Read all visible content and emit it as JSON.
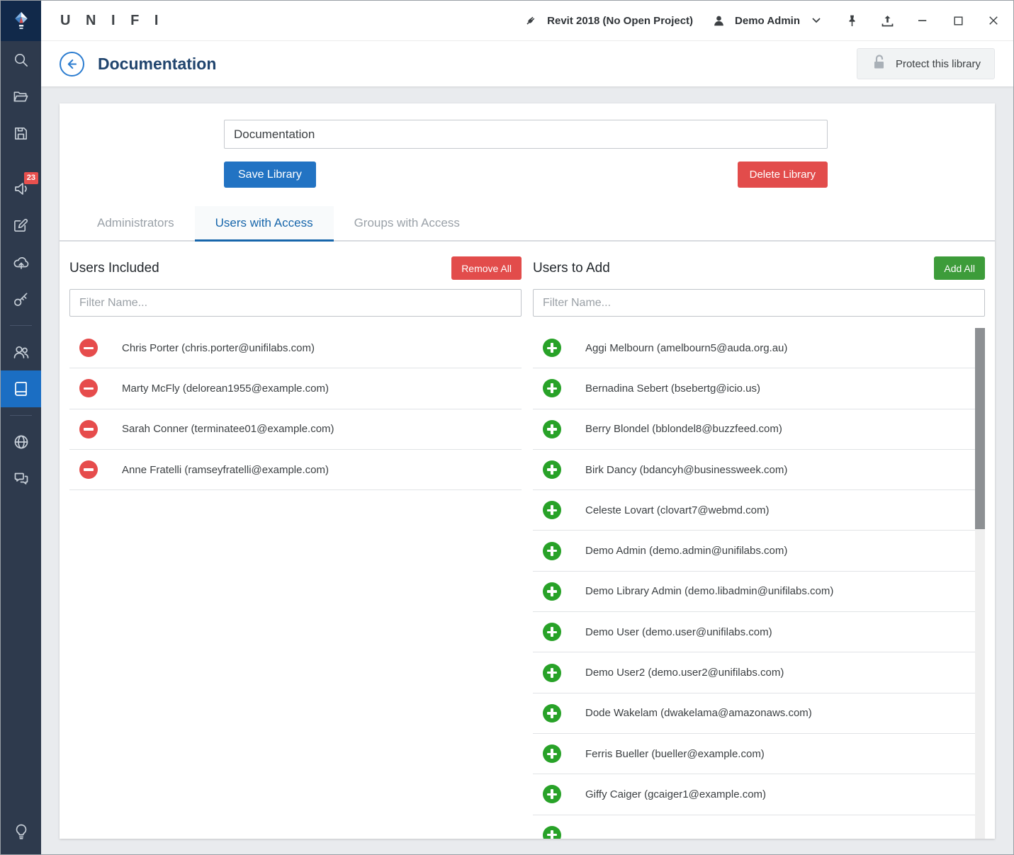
{
  "colors": {
    "sidebar_bg": "#2e3a4d",
    "sidebar_active_bg": "#1b6ec3",
    "accent_blue": "#2273c3",
    "danger_red": "#e24c4b",
    "success_green": "#3d9c3a",
    "badge_red": "#e8504e",
    "title_navy": "#21456e",
    "tab_active_blue": "#1766ab"
  },
  "titlebar": {
    "app_name": "U N I F I",
    "revit_status": "Revit 2018 (No Open Project)",
    "user_name": "Demo Admin",
    "icons": [
      "revit-plugin-icon",
      "user-icon",
      "chevron-down-icon",
      "pin-icon",
      "upload-icon",
      "minimize-icon",
      "maximize-icon",
      "close-icon"
    ]
  },
  "sidebar": {
    "badge_count": "23",
    "active_item": "library-book-icon",
    "icons": [
      "unifi-logo",
      "search-icon",
      "folder-open-icon",
      "save-icon",
      "megaphone-icon",
      "edit-icon",
      "cloud-upload-icon",
      "key-icon",
      "users-icon",
      "library-book-icon",
      "globe-icon",
      "chat-icon",
      "lightbulb-icon"
    ]
  },
  "header": {
    "title": "Documentation",
    "protect_button_label": "Protect this library"
  },
  "library_form": {
    "name_value": "Documentation",
    "save_label": "Save Library",
    "delete_label": "Delete Library"
  },
  "tabs": [
    {
      "label": "Administrators",
      "active": false
    },
    {
      "label": "Users with Access",
      "active": true
    },
    {
      "label": "Groups with Access",
      "active": false
    }
  ],
  "users_included": {
    "title": "Users Included",
    "action_label": "Remove All",
    "filter_placeholder": "Filter Name...",
    "users": [
      "Chris Porter (chris.porter@unifilabs.com)",
      "Marty McFly (delorean1955@example.com)",
      "Sarah Conner (terminatee01@example.com)",
      "Anne Fratelli (ramseyfratelli@example.com)"
    ]
  },
  "users_to_add": {
    "title": "Users to Add",
    "action_label": "Add All",
    "filter_placeholder": "Filter Name...",
    "users": [
      "Aggi Melbourn (amelbourn5@auda.org.au)",
      "Bernadina Sebert (bsebertg@icio.us)",
      "Berry Blondel (bblondel8@buzzfeed.com)",
      "Birk Dancy (bdancyh@businessweek.com)",
      "Celeste Lovart (clovart7@webmd.com)",
      "Demo Admin (demo.admin@unifilabs.com)",
      "Demo Library Admin (demo.libadmin@unifilabs.com)",
      "Demo User (demo.user@unifilabs.com)",
      "Demo User2 (demo.user2@unifilabs.com)",
      "Dode Wakelam (dwakelama@amazonaws.com)",
      "Ferris Bueller (bueller@example.com)",
      "Giffy Caiger (gcaiger1@example.com)"
    ]
  }
}
